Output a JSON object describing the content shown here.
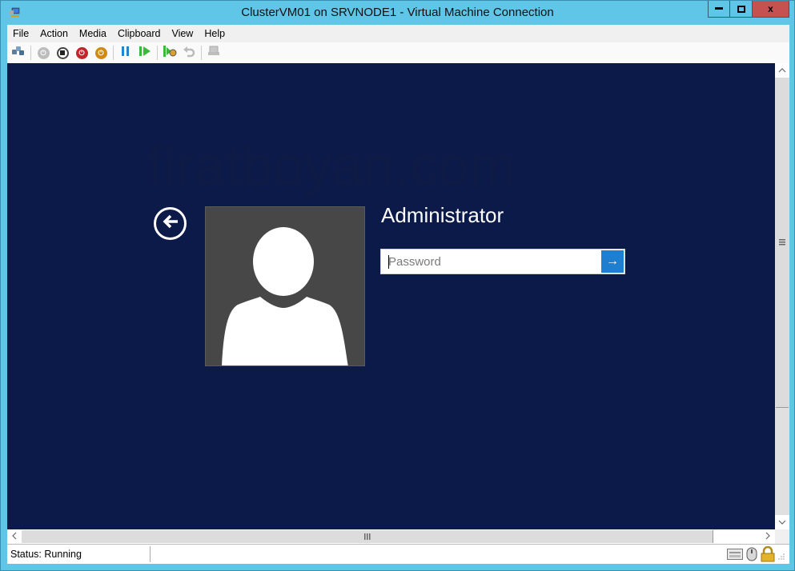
{
  "window": {
    "title": "ClusterVM01 on SRVNODE1 - Virtual Machine Connection",
    "controls": {
      "minimize": "▁",
      "maximize": "□",
      "close": "x"
    }
  },
  "menu": {
    "items": [
      {
        "label": "File"
      },
      {
        "label": "Action"
      },
      {
        "label": "Media"
      },
      {
        "label": "Clipboard"
      },
      {
        "label": "View"
      },
      {
        "label": "Help"
      }
    ]
  },
  "toolbar": {
    "buttons": [
      {
        "name": "ctrl-alt-del",
        "icon": "ctrl-alt-del-icon",
        "enabled": true
      },
      {
        "name": "start",
        "icon": "power-icon",
        "enabled": false
      },
      {
        "name": "turn-off",
        "icon": "stop-icon",
        "enabled": true
      },
      {
        "name": "shut-down",
        "icon": "shutdown-icon",
        "enabled": true,
        "color": "#c0262c"
      },
      {
        "name": "save",
        "icon": "save-state-icon",
        "enabled": true,
        "color": "#d08a14"
      },
      {
        "name": "pause",
        "icon": "pause-icon",
        "enabled": true,
        "color": "#1e86d0"
      },
      {
        "name": "resume",
        "icon": "resume-icon",
        "enabled": true,
        "color": "#3cb83c"
      },
      {
        "name": "checkpoint",
        "icon": "checkpoint-icon",
        "enabled": true
      },
      {
        "name": "revert",
        "icon": "revert-icon",
        "enabled": false
      },
      {
        "name": "enhanced-session",
        "icon": "enhanced-session-icon",
        "enabled": false
      }
    ]
  },
  "vm_screen": {
    "watermark": "firatboyan.com",
    "background_color": "#0b1a48",
    "username": "Administrator",
    "password": {
      "value": "",
      "placeholder": "Password"
    },
    "submit_icon": "→",
    "back_icon": "←"
  },
  "statusbar": {
    "status": "Status: Running"
  }
}
